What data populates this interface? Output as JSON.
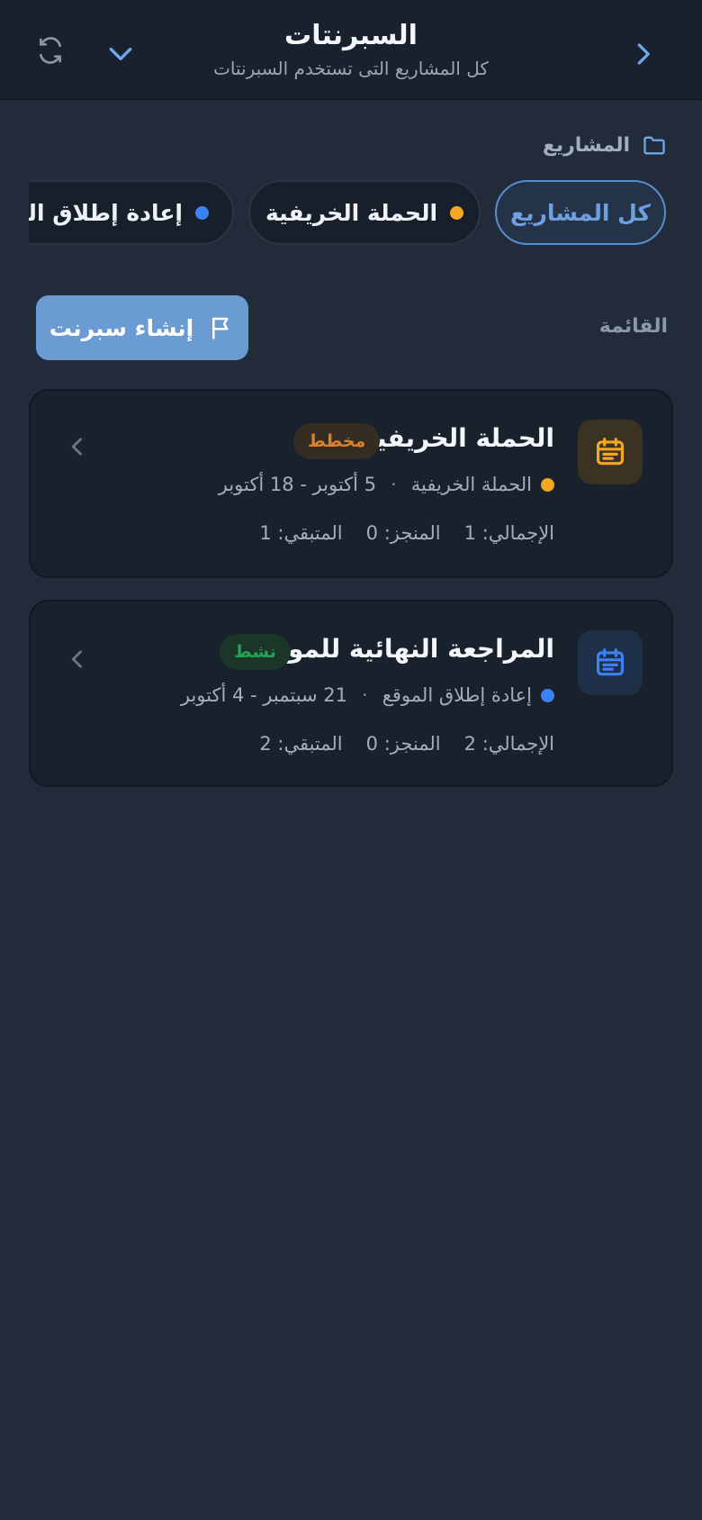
{
  "header": {
    "title": "السبرنتات",
    "subtitle": "كل المشاريع التى تستخدم السبرنتات"
  },
  "projects": {
    "label": "المشاريع",
    "chips": [
      {
        "label": "كل المشاريع",
        "active": true
      },
      {
        "label": "الحملة الخريفية",
        "dot_color": "#f5a623"
      },
      {
        "label": "إعادة إطلاق الموقع",
        "dot_color": "#3b82f6"
      }
    ]
  },
  "list": {
    "label": "القائمة",
    "create_label": "إنشاء سبرنت"
  },
  "sprints": [
    {
      "title": "الحملة الخريفية",
      "status": "مخطط",
      "project": "الحملة الخريفية",
      "dates": "5 أكتوبر - 18 أكتوبر",
      "total": "الإجمالي: 1",
      "done": "المنجز: 0",
      "remaining": "المتبقي: 1",
      "dot_color": "#f5a623"
    },
    {
      "title": "المراجعة النهائية للموقع",
      "status": "نشط",
      "project": "إعادة إطلاق الموقع",
      "dates": "21 سبتمبر - 4 أكتوبر",
      "total": "الإجمالي: 2",
      "done": "المنجز: 0",
      "remaining": "المتبقي: 2",
      "dot_color": "#3b82f6"
    }
  ],
  "colors": {
    "accent": "#6b9bd3",
    "planned": "#d9802e",
    "active": "#21a353"
  }
}
